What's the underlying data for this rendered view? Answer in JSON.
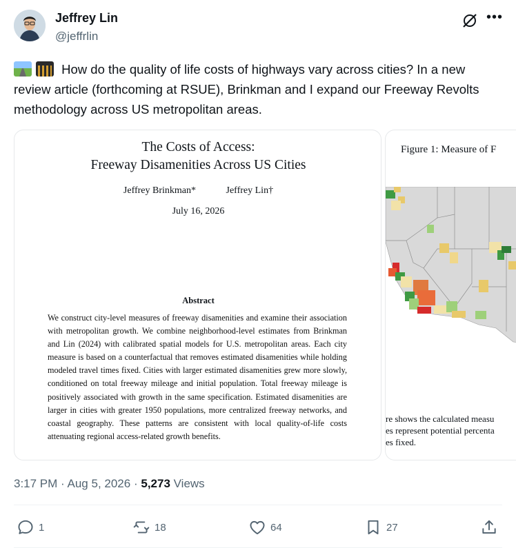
{
  "author": {
    "name": "Jeffrey Lin",
    "handle": "@jeffrlin"
  },
  "header_icons": [
    "grok-icon",
    "more-icon"
  ],
  "more_label": "•••",
  "tweet": {
    "emojis": [
      "motorway-emoji",
      "cityscape-at-dusk-emoji"
    ],
    "text": "How do the quality of life costs of highways vary across cities? In a new review article (forthcoming at RSUE), Brinkman and I expand our Freeway Revolts methodology across US metropolitan areas."
  },
  "paper": {
    "title_line1": "The Costs of Access:",
    "title_line2": "Freeway Disamenities Across US Cities",
    "author1": "Jeffrey Brinkman*",
    "author2": "Jeffrey Lin†",
    "date": "July 16, 2026",
    "abstract_heading": "Abstract",
    "abstract_text": "We construct city-level measures of freeway disamenities and examine their association with metropolitan growth. We combine neighborhood-level estimates from Brinkman and Lin (2024) with calibrated spatial models for U.S. metropolitan areas. Each city measure is based on a counterfactual that removes estimated disamenities while holding modeled travel times fixed. Cities with larger estimated disamenities grew more slowly, conditioned on total freeway mileage and initial population. Total freeway mileage is positively associated with growth in the same specification. Estimated disamenities are larger in cities with greater 1950 populations, more centralized freeway networks, and coastal geography. These patterns are consistent with local quality-of-life costs attenuating regional access-related growth benefits."
  },
  "figure": {
    "title": "Figure 1: Measure of F",
    "caption_line1": "re shows the calculated measu",
    "caption_line2": "es represent potential percenta",
    "caption_line3": "es fixed."
  },
  "meta": {
    "time": "3:17 PM",
    "date": "Aug 5, 2026",
    "views_count": "5,273",
    "views_label": "Views",
    "sep": "·"
  },
  "actions": {
    "replies": "1",
    "reposts": "18",
    "likes": "64",
    "bookmarks": "27"
  },
  "colors": {
    "text": "#0f1419",
    "secondary": "#536471",
    "map_high": "#d62b2b",
    "map_mid": "#e8c96a",
    "map_low": "#3f9a43"
  }
}
